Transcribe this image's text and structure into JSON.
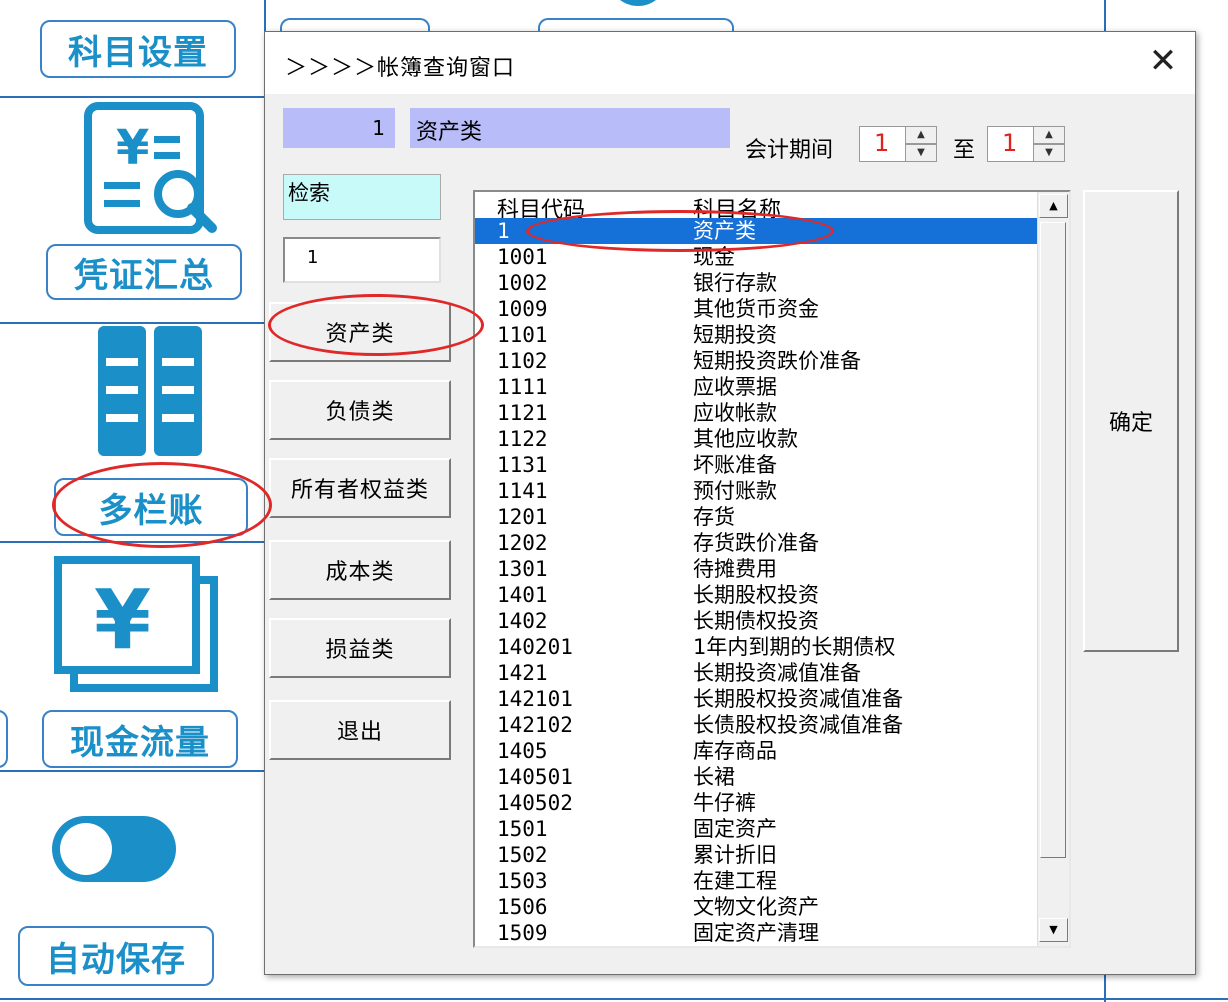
{
  "sidebar": {
    "subject_settings": "科目设置",
    "voucher_summary": "凭证汇总",
    "multi_column_ledger": "多栏账",
    "cash_flow": "现金流量",
    "auto_save": "自动保存"
  },
  "dialog": {
    "title": "＞＞＞＞帐簿查询窗口",
    "close_glyph": "✕",
    "current_code": "1",
    "current_name": "资产类",
    "period_label": "会计期间",
    "period_from": "1",
    "period_to_label": "至",
    "period_to": "1",
    "search_label": "检索",
    "search_value": "1",
    "categories": [
      "资产类",
      "负债类",
      "所有者权益类",
      "成本类",
      "损益类"
    ],
    "exit_label": "退出",
    "confirm_label": "确定",
    "list": {
      "headers": {
        "code": "科目代码",
        "name": "科目名称"
      },
      "rows": [
        {
          "code": "1",
          "name": "资产类",
          "selected": true
        },
        {
          "code": "1001",
          "name": "现金"
        },
        {
          "code": "1002",
          "name": "银行存款"
        },
        {
          "code": "1009",
          "name": "其他货币资金"
        },
        {
          "code": "1101",
          "name": "短期投资"
        },
        {
          "code": "1102",
          "name": "短期投资跌价准备"
        },
        {
          "code": "1111",
          "name": "应收票据"
        },
        {
          "code": "1121",
          "name": "应收帐款"
        },
        {
          "code": "1122",
          "name": "其他应收款"
        },
        {
          "code": "1131",
          "name": "坏账准备"
        },
        {
          "code": "1141",
          "name": "预付账款"
        },
        {
          "code": "1201",
          "name": "存货"
        },
        {
          "code": "1202",
          "name": "存货跌价准备"
        },
        {
          "code": "1301",
          "name": "待摊费用"
        },
        {
          "code": "1401",
          "name": "长期股权投资"
        },
        {
          "code": "1402",
          "name": "长期债权投资"
        },
        {
          "code": "140201",
          "name": "1年内到期的长期债权"
        },
        {
          "code": "1421",
          "name": "长期投资减值准备"
        },
        {
          "code": "142101",
          "name": "长期股权投资减值准备"
        },
        {
          "code": "142102",
          "name": "长债股权投资减值准备"
        },
        {
          "code": "1405",
          "name": "库存商品"
        },
        {
          "code": "140501",
          "name": "长裙"
        },
        {
          "code": "140502",
          "name": "牛仔裤"
        },
        {
          "code": "1501",
          "name": "固定资产"
        },
        {
          "code": "1502",
          "name": "累计折旧"
        },
        {
          "code": "1503",
          "name": "在建工程"
        },
        {
          "code": "1506",
          "name": "文物文化资产"
        },
        {
          "code": "1509",
          "name": "固定资产清理"
        }
      ]
    }
  },
  "colors": {
    "accent_blue": "#1a8fc8",
    "selection": "#1570d8",
    "annotation_red": "#e02828",
    "code_bar": "#b8bcf8",
    "search_bar": "#c8fafa"
  }
}
